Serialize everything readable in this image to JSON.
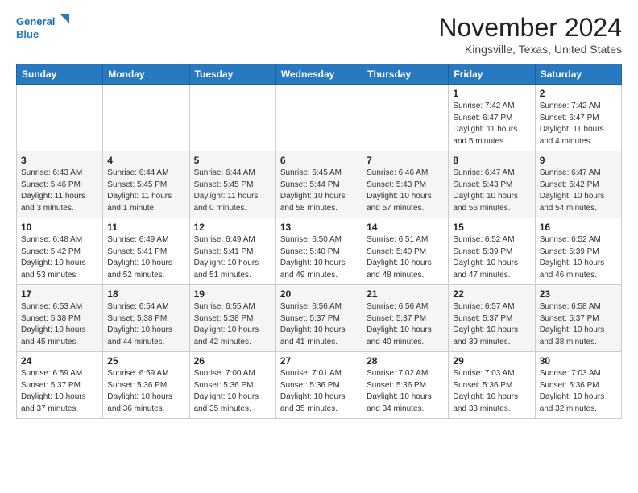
{
  "header": {
    "logo_line1": "General",
    "logo_line2": "Blue",
    "month": "November 2024",
    "location": "Kingsville, Texas, United States"
  },
  "days_of_week": [
    "Sunday",
    "Monday",
    "Tuesday",
    "Wednesday",
    "Thursday",
    "Friday",
    "Saturday"
  ],
  "weeks": [
    [
      {
        "day": "",
        "info": ""
      },
      {
        "day": "",
        "info": ""
      },
      {
        "day": "",
        "info": ""
      },
      {
        "day": "",
        "info": ""
      },
      {
        "day": "",
        "info": ""
      },
      {
        "day": "1",
        "info": "Sunrise: 7:42 AM\nSunset: 6:47 PM\nDaylight: 11 hours\nand 5 minutes."
      },
      {
        "day": "2",
        "info": "Sunrise: 7:42 AM\nSunset: 6:47 PM\nDaylight: 11 hours\nand 4 minutes."
      }
    ],
    [
      {
        "day": "3",
        "info": "Sunrise: 6:43 AM\nSunset: 5:46 PM\nDaylight: 11 hours\nand 3 minutes."
      },
      {
        "day": "4",
        "info": "Sunrise: 6:44 AM\nSunset: 5:45 PM\nDaylight: 11 hours\nand 1 minute."
      },
      {
        "day": "5",
        "info": "Sunrise: 6:44 AM\nSunset: 5:45 PM\nDaylight: 11 hours\nand 0 minutes."
      },
      {
        "day": "6",
        "info": "Sunrise: 6:45 AM\nSunset: 5:44 PM\nDaylight: 10 hours\nand 58 minutes."
      },
      {
        "day": "7",
        "info": "Sunrise: 6:46 AM\nSunset: 5:43 PM\nDaylight: 10 hours\nand 57 minutes."
      },
      {
        "day": "8",
        "info": "Sunrise: 6:47 AM\nSunset: 5:43 PM\nDaylight: 10 hours\nand 56 minutes."
      },
      {
        "day": "9",
        "info": "Sunrise: 6:47 AM\nSunset: 5:42 PM\nDaylight: 10 hours\nand 54 minutes."
      }
    ],
    [
      {
        "day": "10",
        "info": "Sunrise: 6:48 AM\nSunset: 5:42 PM\nDaylight: 10 hours\nand 53 minutes."
      },
      {
        "day": "11",
        "info": "Sunrise: 6:49 AM\nSunset: 5:41 PM\nDaylight: 10 hours\nand 52 minutes."
      },
      {
        "day": "12",
        "info": "Sunrise: 6:49 AM\nSunset: 5:41 PM\nDaylight: 10 hours\nand 51 minutes."
      },
      {
        "day": "13",
        "info": "Sunrise: 6:50 AM\nSunset: 5:40 PM\nDaylight: 10 hours\nand 49 minutes."
      },
      {
        "day": "14",
        "info": "Sunrise: 6:51 AM\nSunset: 5:40 PM\nDaylight: 10 hours\nand 48 minutes."
      },
      {
        "day": "15",
        "info": "Sunrise: 6:52 AM\nSunset: 5:39 PM\nDaylight: 10 hours\nand 47 minutes."
      },
      {
        "day": "16",
        "info": "Sunrise: 6:52 AM\nSunset: 5:39 PM\nDaylight: 10 hours\nand 46 minutes."
      }
    ],
    [
      {
        "day": "17",
        "info": "Sunrise: 6:53 AM\nSunset: 5:38 PM\nDaylight: 10 hours\nand 45 minutes."
      },
      {
        "day": "18",
        "info": "Sunrise: 6:54 AM\nSunset: 5:38 PM\nDaylight: 10 hours\nand 44 minutes."
      },
      {
        "day": "19",
        "info": "Sunrise: 6:55 AM\nSunset: 5:38 PM\nDaylight: 10 hours\nand 42 minutes."
      },
      {
        "day": "20",
        "info": "Sunrise: 6:56 AM\nSunset: 5:37 PM\nDaylight: 10 hours\nand 41 minutes."
      },
      {
        "day": "21",
        "info": "Sunrise: 6:56 AM\nSunset: 5:37 PM\nDaylight: 10 hours\nand 40 minutes."
      },
      {
        "day": "22",
        "info": "Sunrise: 6:57 AM\nSunset: 5:37 PM\nDaylight: 10 hours\nand 39 minutes."
      },
      {
        "day": "23",
        "info": "Sunrise: 6:58 AM\nSunset: 5:37 PM\nDaylight: 10 hours\nand 38 minutes."
      }
    ],
    [
      {
        "day": "24",
        "info": "Sunrise: 6:59 AM\nSunset: 5:37 PM\nDaylight: 10 hours\nand 37 minutes."
      },
      {
        "day": "25",
        "info": "Sunrise: 6:59 AM\nSunset: 5:36 PM\nDaylight: 10 hours\nand 36 minutes."
      },
      {
        "day": "26",
        "info": "Sunrise: 7:00 AM\nSunset: 5:36 PM\nDaylight: 10 hours\nand 35 minutes."
      },
      {
        "day": "27",
        "info": "Sunrise: 7:01 AM\nSunset: 5:36 PM\nDaylight: 10 hours\nand 35 minutes."
      },
      {
        "day": "28",
        "info": "Sunrise: 7:02 AM\nSunset: 5:36 PM\nDaylight: 10 hours\nand 34 minutes."
      },
      {
        "day": "29",
        "info": "Sunrise: 7:03 AM\nSunset: 5:36 PM\nDaylight: 10 hours\nand 33 minutes."
      },
      {
        "day": "30",
        "info": "Sunrise: 7:03 AM\nSunset: 5:36 PM\nDaylight: 10 hours\nand 32 minutes."
      }
    ]
  ]
}
